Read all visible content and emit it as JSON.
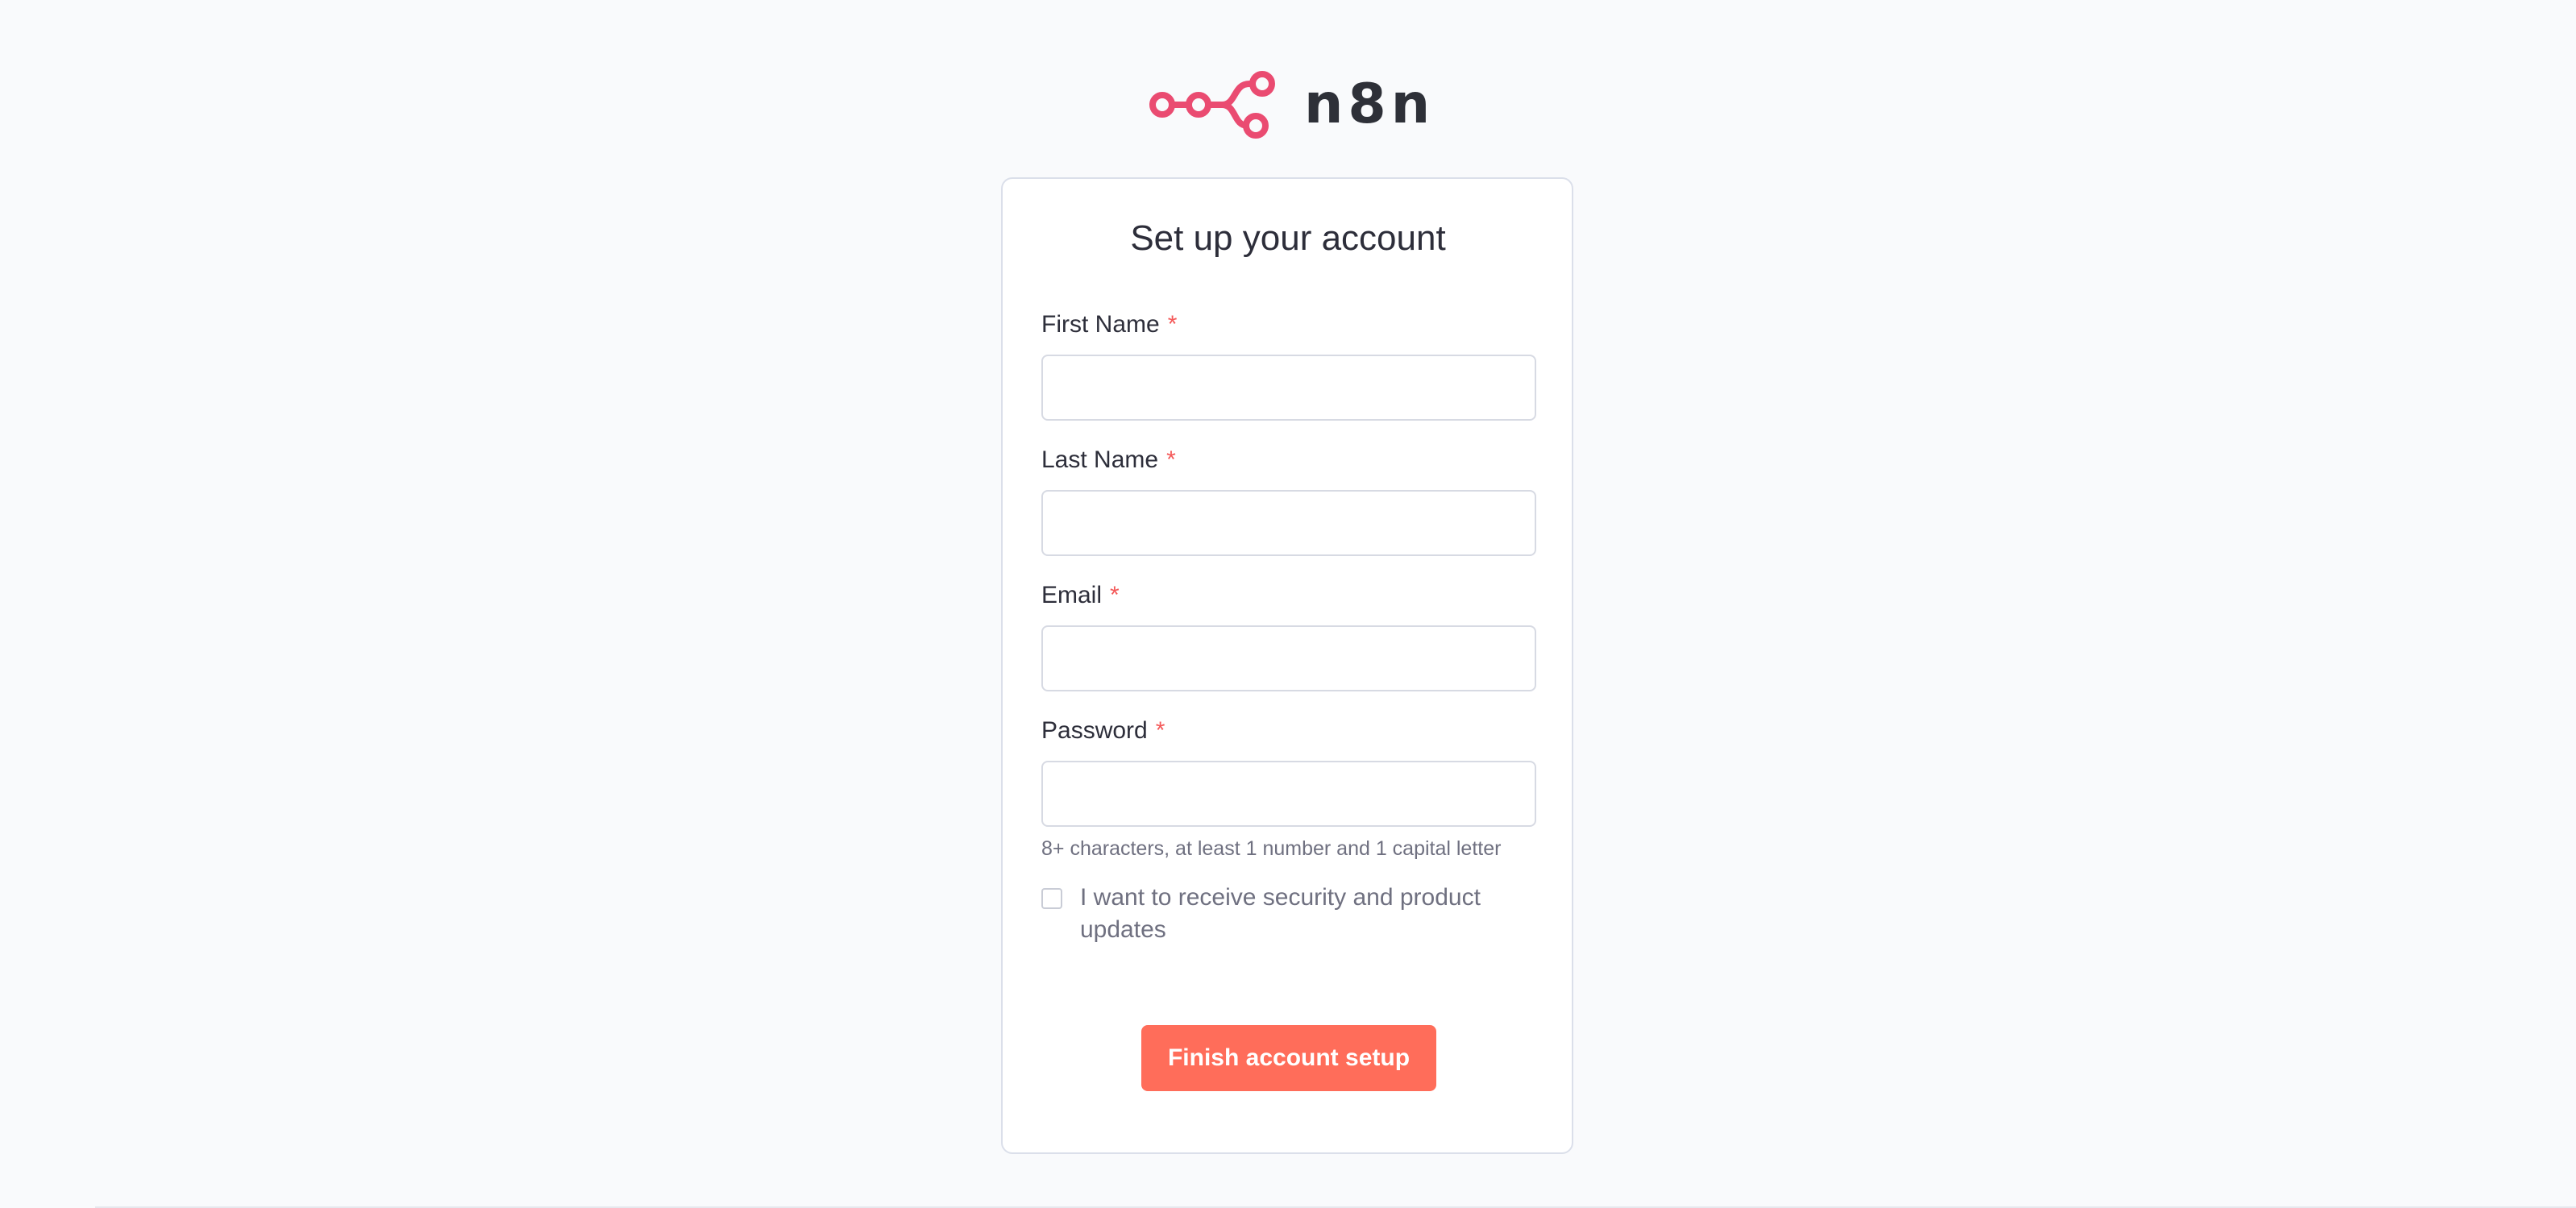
{
  "brand": {
    "logo_icon": "n8n-logo-icon",
    "name": "n8n",
    "logo_color": "#ea4b71"
  },
  "form": {
    "title": "Set up your account",
    "required_mark": "*",
    "fields": [
      {
        "label": "First Name",
        "value": "",
        "placeholder": ""
      },
      {
        "label": "Last Name",
        "value": "",
        "placeholder": ""
      },
      {
        "label": "Email",
        "value": "",
        "placeholder": ""
      },
      {
        "label": "Password",
        "value": "",
        "placeholder": ""
      }
    ],
    "password_hint": "8+ characters, at least 1 number and 1 capital letter",
    "updates_checkbox": {
      "label": "I want to receive security and product updates",
      "checked": false
    },
    "submit_label": "Finish account setup"
  },
  "colors": {
    "accent": "#ff6d5a",
    "required": "#f45959",
    "background": "#f9fafc"
  }
}
